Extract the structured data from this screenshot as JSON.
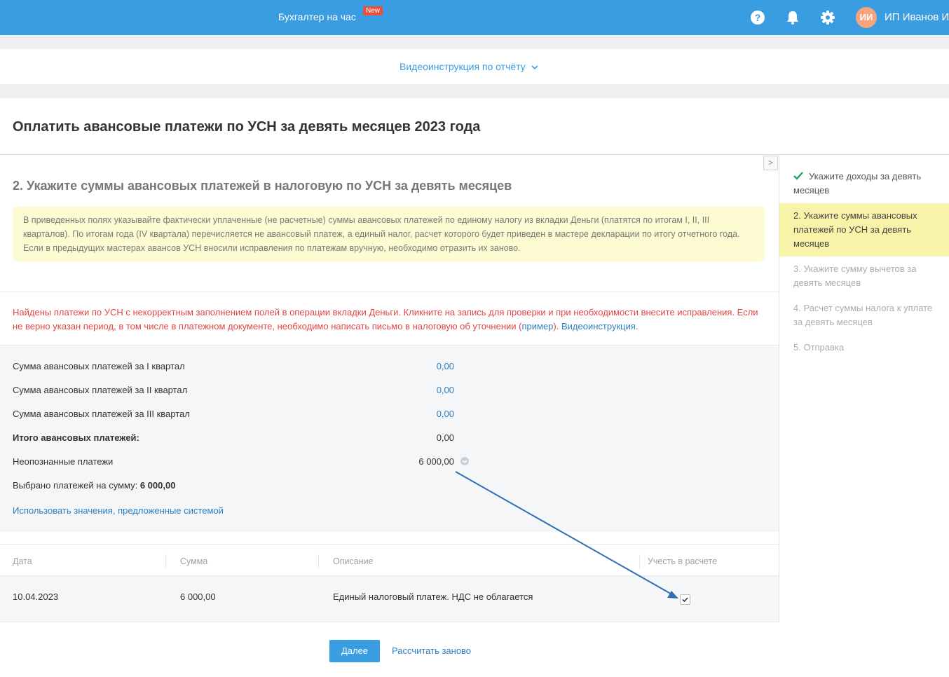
{
  "topbar": {
    "accountant_label": "Бухгалтер на час",
    "new_badge": "New",
    "avatar_initials": "ИИ",
    "username": "ИП Иванов И"
  },
  "videobar": {
    "link_label": "Видеоинструкция по отчёту"
  },
  "page": {
    "title": "Оплатить авансовые платежи по УСН за девять месяцев 2023 года",
    "step_title": "2. Укажите суммы авансовых платежей в налоговую по УСН за девять месяцев",
    "notice": "В приведенных полях указывайте фактически уплаченные (не расчетные) суммы авансовых платежей по единому налогу из вкладки Деньги (платятся по итогам I, II, III кварталов). По итогам года (IV квартала) перечисляется не авансовый платеж, а единый налог, расчет которого будет приведен в мастере декларации по итогу отчетного года. Если в предыдущих мастерах авансов УСН вносили исправления по платежам вручную, необходимо отразить их заново.",
    "warning_text": "Найдены платежи по УСН с некорректным заполнением полей в операции вкладки Деньги. Кликните на запись для проверки и при необходимости внесите исправления. Если не верно указан период, в том числе в платежном документе, необходимо написать письмо в налоговую об уточнении (",
    "warning_example": "пример",
    "warning_mid": "). ",
    "warning_video": "Видеоинструкция",
    "warning_end": "."
  },
  "summary": {
    "q1_label": "Сумма авансовых платежей за I квартал",
    "q1_value": "0,00",
    "q2_label": "Сумма авансовых платежей за II квартал",
    "q2_value": "0,00",
    "q3_label": "Сумма авансовых платежей за III квартал",
    "q3_value": "0,00",
    "total_label": "Итого авансовых платежей:",
    "total_value": "0,00",
    "unrecognized_label": "Неопознанные платежи",
    "unrecognized_value": "6 000,00",
    "selected_label": "Выбрано платежей на сумму: ",
    "selected_value": "6 000,00",
    "use_suggested": "Использовать значения, предложенные системой"
  },
  "table": {
    "columns": [
      "Дата",
      "Сумма",
      "Описание",
      "Учесть в расчете"
    ],
    "rows": [
      {
        "date": "10.04.2023",
        "amount": "6 000,00",
        "description": "Единый налоговый платеж. НДС не облагается",
        "checked": true
      }
    ]
  },
  "buttons": {
    "next": "Далее",
    "recalc": "Рассчитать заново"
  },
  "sidebar": {
    "steps": [
      {
        "label": "Укажите доходы за девять месяцев",
        "state": "done"
      },
      {
        "label": "2.  Укажите суммы авансовых платежей по УСН за девять месяцев",
        "state": "active"
      },
      {
        "label": "3.  Укажите сумму вычетов за девять месяцев",
        "state": "pending"
      },
      {
        "label": "4.  Расчет суммы налога к уплате за девять месяцев",
        "state": "pending"
      },
      {
        "label": "5.  Отправка",
        "state": "pending"
      }
    ]
  },
  "colors": {
    "brand": "#3a9de1",
    "warning": "#e54545",
    "link": "#2d7fc2",
    "active_step": "#f7f3a9",
    "notice_bg": "#fdfbd1",
    "check": "#27a35f"
  }
}
